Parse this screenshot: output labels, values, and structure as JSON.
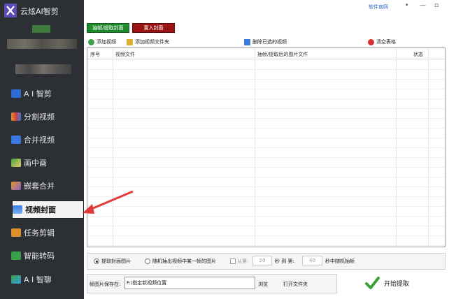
{
  "app": {
    "title": "云炫AI智剪",
    "link": "软件官网",
    "win_controls": [
      "•",
      "—",
      "▫",
      "✕"
    ]
  },
  "sidebar": {
    "items": [
      {
        "label": "A I 智剪",
        "icon": "scissors-icon",
        "color": "#2f6ad6"
      },
      {
        "label": "分割视频",
        "icon": "split-icon",
        "color": "#e0902a"
      },
      {
        "label": "合并视频",
        "icon": "merge-icon",
        "color": "#3a7ae0"
      },
      {
        "label": "画中画",
        "icon": "picture-in-picture-icon",
        "color": "#4aa04a"
      },
      {
        "label": "嵌套合并",
        "icon": "nest-icon",
        "color": "#e0a020"
      },
      {
        "label": "视频封面",
        "icon": "cover-icon",
        "color": "#3a7ae0",
        "active": true
      },
      {
        "label": "任务剪辑",
        "icon": "task-icon",
        "color": "#e0902a"
      },
      {
        "label": "智能转码",
        "icon": "transcode-icon",
        "color": "#3aa04a"
      },
      {
        "label": "A I 智聊",
        "icon": "chat-icon",
        "color": "#3a9ae0"
      }
    ]
  },
  "mode_buttons": {
    "extract": "抽帧/提取封面",
    "insert": "置入封面"
  },
  "toolbar": {
    "add_video": "添加视频",
    "add_folder": "添加视频文件夹",
    "remove_selected": "删除已选的视频",
    "clear_table": "清空表格"
  },
  "table": {
    "columns": [
      "序号",
      "视频文件",
      "抽帧/提取后的图片文件",
      "状态"
    ],
    "rows": []
  },
  "options": {
    "extract_cover": "提取封面图片",
    "random_frame": "随机抽出视频中某一帧的图片",
    "from_label": "从第:",
    "from_value": "20",
    "sec_to": "秒 到 第:",
    "to_value": "40",
    "sec_random": "秒中随机抽帧"
  },
  "save": {
    "label": "帧图片保存在:",
    "path": "F:\\指定新视频位置",
    "browse": "浏览",
    "open_folder": "打开文件夹"
  },
  "start_button": "开始提取"
}
